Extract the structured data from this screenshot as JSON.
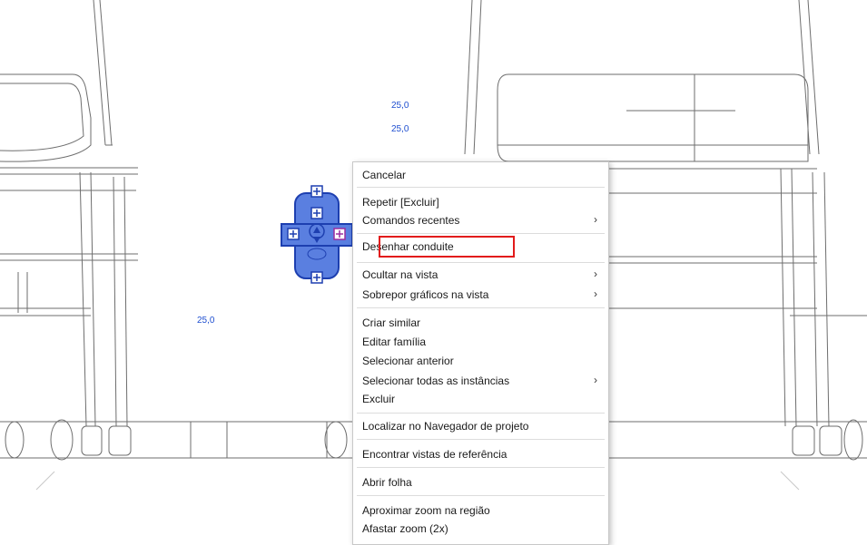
{
  "dimensions": {
    "label_1": "25,0",
    "label_2": "25,0",
    "label_3": "25,0"
  },
  "context_menu": {
    "items": [
      {
        "label": "Cancelar"
      },
      {
        "label": "Repetir [Excluir]"
      },
      {
        "label": "Comandos recentes",
        "submenu": "›"
      },
      {
        "label": "Desenhar conduite"
      },
      {
        "label": "Ocultar na vista",
        "submenu": "›"
      },
      {
        "label": "Sobrepor gráficos na vista",
        "submenu": "›"
      },
      {
        "label": "Criar similar"
      },
      {
        "label": "Editar família"
      },
      {
        "label": "Selecionar anterior"
      },
      {
        "label": "Selecionar todas as instâncias",
        "submenu": "›"
      },
      {
        "label": "Excluir"
      },
      {
        "label": "Localizar no Navegador de projeto"
      },
      {
        "label": "Encontrar vistas de referência"
      },
      {
        "label": "Abrir folha"
      },
      {
        "label": "Aproximar zoom na região"
      },
      {
        "label": "Afastar zoom (2x)"
      }
    ]
  },
  "colors": {
    "selection_fill": "#5a7fe0",
    "selection_stroke": "#1d3fb0",
    "dimension_text": "#1f4fd0",
    "highlight_border": "#e21b1b"
  }
}
